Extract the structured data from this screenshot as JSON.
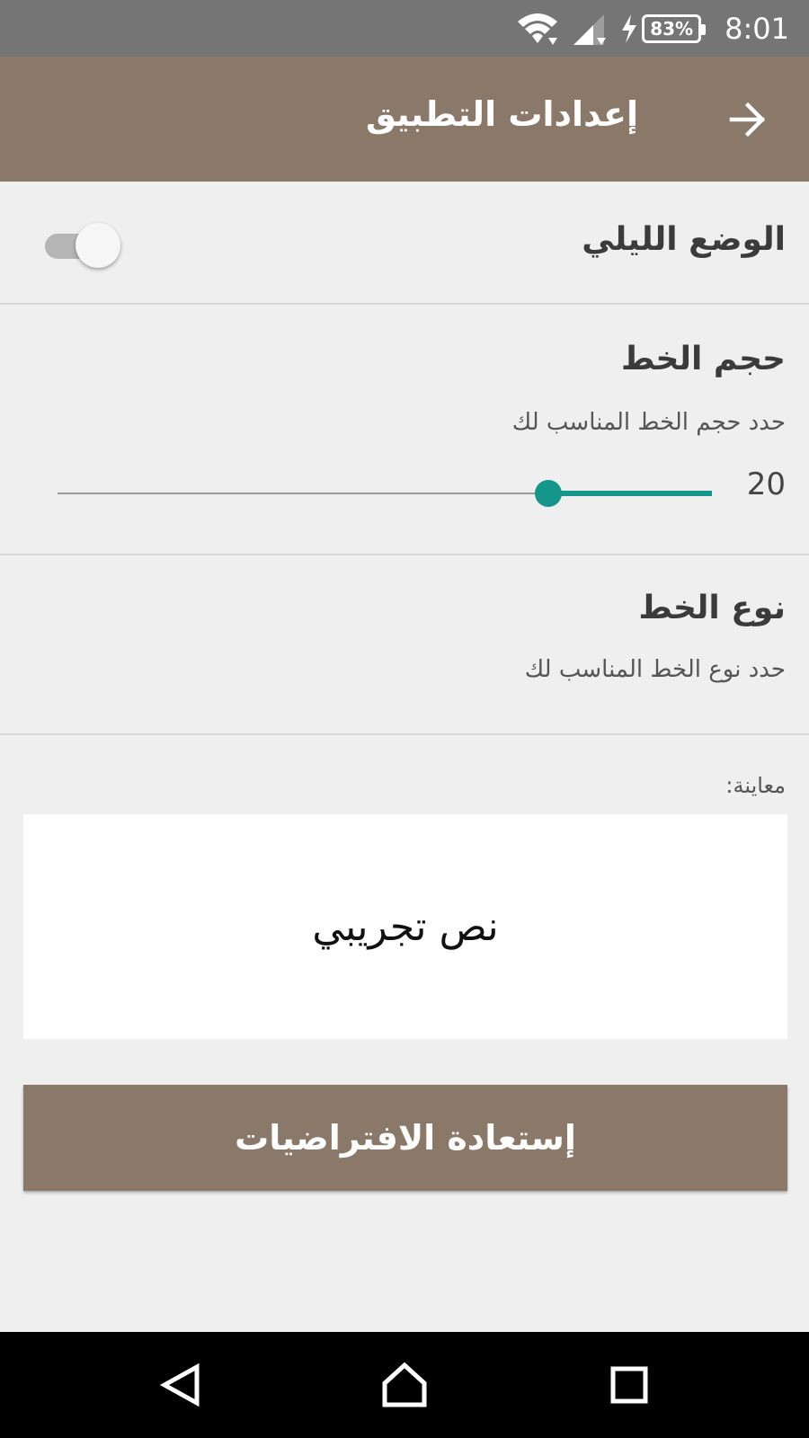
{
  "status_bar": {
    "battery_percent": "83%",
    "time": "8:01",
    "icons": [
      "wifi-icon",
      "signal-icon",
      "charging-icon",
      "battery-icon"
    ]
  },
  "app_bar": {
    "title": "إعدادات التطبيق",
    "back_icon": "arrow-right-icon"
  },
  "settings": {
    "night_mode": {
      "label": "الوضع الليلي",
      "enabled": false
    },
    "font_size": {
      "label": "حجم الخط",
      "description": "حدد حجم الخط المناسب لك",
      "value": "20",
      "fraction": 0.25
    },
    "font_type": {
      "label": "نوع الخط",
      "description": "حدد نوع الخط المناسب لك"
    }
  },
  "preview": {
    "label": "معاينة:",
    "sample_text": "نص تجريبي"
  },
  "restore_button": {
    "label": "إستعادة الافتراضيات"
  },
  "nav_bar": {
    "icons": [
      "back-triangle-icon",
      "home-icon",
      "recent-apps-icon"
    ]
  },
  "colors": {
    "primary": "#8a7869",
    "accent": "#14968a",
    "status_bar": "#757575",
    "background": "#efefef"
  }
}
